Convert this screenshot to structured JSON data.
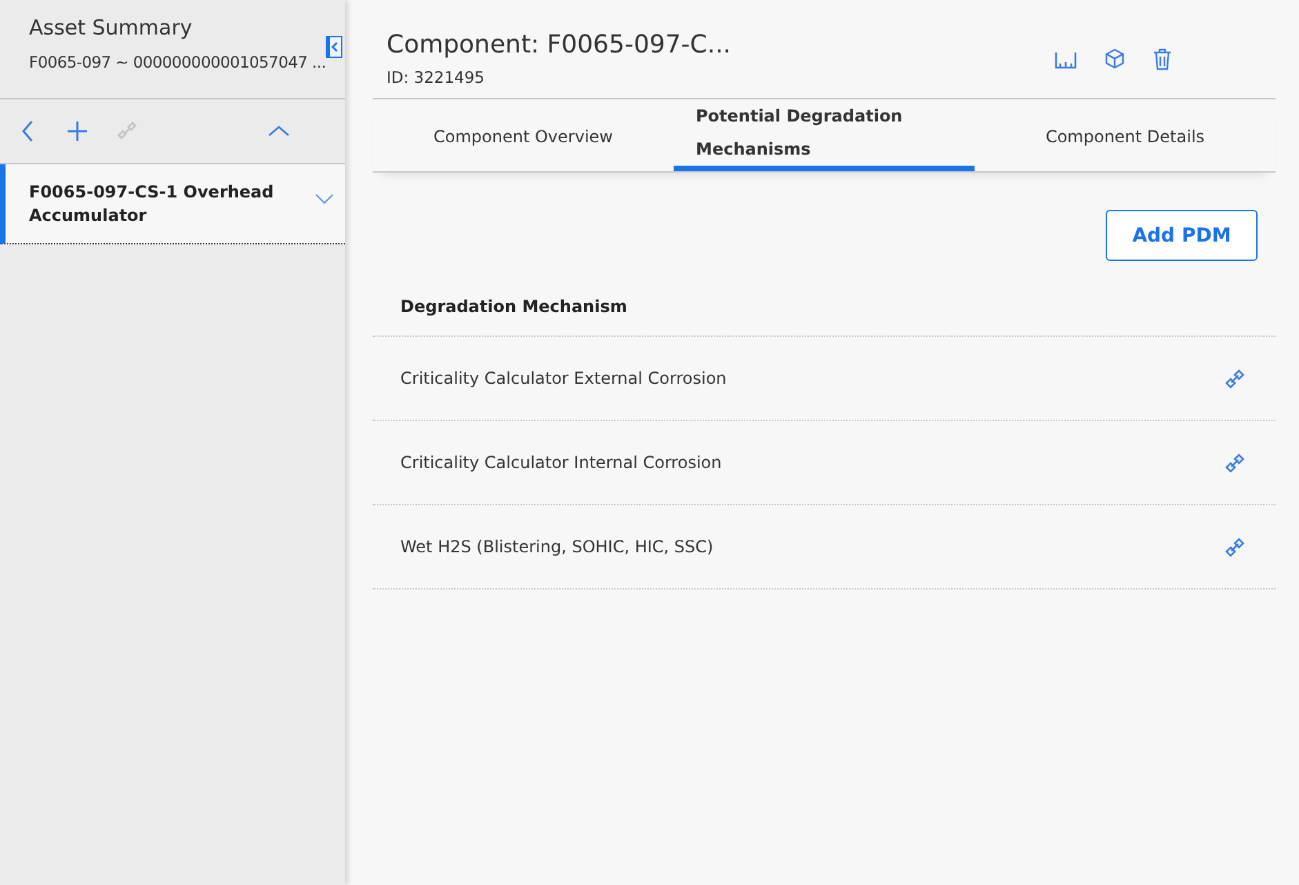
{
  "sidebar": {
    "title": "Asset Summary",
    "subtitle": "F0065-097 ~ 000000000001057047 ...",
    "toolbar": [
      {
        "kind": "back",
        "disabled": false
      },
      {
        "kind": "add",
        "disabled": false
      },
      {
        "kind": "link",
        "disabled": true
      },
      {
        "kind": "collapse",
        "disabled": false
      }
    ],
    "items": [
      {
        "label": "F0065-097-CS-1 Overhead Accumulator",
        "selected": true
      }
    ]
  },
  "header": {
    "title": "Component: F0065-097-C...",
    "id": "ID: 3221495"
  },
  "tabs": [
    {
      "label": "Component Overview",
      "selected": false
    },
    {
      "label": "Potential Degradation Mechanisms",
      "selected": true
    },
    {
      "label": "Component Details",
      "selected": false
    }
  ],
  "add_button": "Add PDM",
  "table": {
    "column": "Degradation Mechanism",
    "rows": [
      {
        "name": "Criticality Calculator External Corrosion"
      },
      {
        "name": "Criticality Calculator Internal Corrosion"
      },
      {
        "name": "Wet H2S (Blistering, SOHIC, HIC, SSC)"
      }
    ]
  }
}
